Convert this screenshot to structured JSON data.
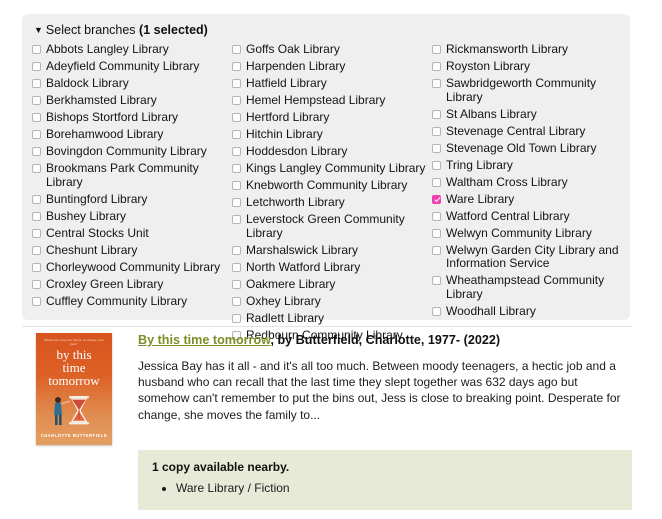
{
  "branch_filter": {
    "caret": "▼",
    "label": "Select branches",
    "count_label": "(1 selected)",
    "columns": [
      {
        "items": [
          {
            "label": "Abbots Langley Library",
            "checked": false
          },
          {
            "label": "Adeyfield Community Library",
            "checked": false
          },
          {
            "label": "Baldock Library",
            "checked": false
          },
          {
            "label": "Berkhamsted Library",
            "checked": false
          },
          {
            "label": "Bishops Stortford Library",
            "checked": false
          },
          {
            "label": "Borehamwood Library",
            "checked": false
          },
          {
            "label": "Bovingdon Community Library",
            "checked": false
          },
          {
            "label": "Brookmans Park Community Library",
            "checked": false
          },
          {
            "label": "Buntingford Library",
            "checked": false
          },
          {
            "label": "Bushey Library",
            "checked": false
          },
          {
            "label": "Central Stocks Unit",
            "checked": false
          },
          {
            "label": "Cheshunt Library",
            "checked": false
          },
          {
            "label": "Chorleywood Community Library",
            "checked": false
          },
          {
            "label": "Croxley Green Library",
            "checked": false
          },
          {
            "label": "Cuffley Community Library",
            "checked": false
          }
        ]
      },
      {
        "items": [
          {
            "label": "Goffs Oak Library",
            "checked": false
          },
          {
            "label": "Harpenden Library",
            "checked": false
          },
          {
            "label": "Hatfield Library",
            "checked": false
          },
          {
            "label": "Hemel Hempstead Library",
            "checked": false
          },
          {
            "label": "Hertford Library",
            "checked": false
          },
          {
            "label": "Hitchin Library",
            "checked": false
          },
          {
            "label": "Hoddesdon Library",
            "checked": false
          },
          {
            "label": "Kings Langley Community Library",
            "checked": false
          },
          {
            "label": "Knebworth Community Library",
            "checked": false
          },
          {
            "label": "Letchworth Library",
            "checked": false
          },
          {
            "label": "Leverstock Green Community Library",
            "checked": false
          },
          {
            "label": "Marshalswick Library",
            "checked": false
          },
          {
            "label": "North Watford Library",
            "checked": false
          },
          {
            "label": "Oakmere Library",
            "checked": false
          },
          {
            "label": "Oxhey Library",
            "checked": false
          },
          {
            "label": "Radlett Library",
            "checked": false
          },
          {
            "label": "Redbourn Community Library",
            "checked": false
          }
        ]
      },
      {
        "items": [
          {
            "label": "Rickmansworth Library",
            "checked": false
          },
          {
            "label": "Royston Library",
            "checked": false
          },
          {
            "label": "Sawbridgeworth Community Library",
            "checked": false
          },
          {
            "label": "St Albans Library",
            "checked": false
          },
          {
            "label": "Stevenage Central Library",
            "checked": false
          },
          {
            "label": "Stevenage Old Town Library",
            "checked": false
          },
          {
            "label": "Tring Library",
            "checked": false
          },
          {
            "label": "Waltham Cross Library",
            "checked": false
          },
          {
            "label": "Ware Library",
            "checked": true
          },
          {
            "label": "Watford Central Library",
            "checked": false
          },
          {
            "label": "Welwyn Community Library",
            "checked": false
          },
          {
            "label": "Welwyn Garden City Library and Information Service",
            "checked": false
          },
          {
            "label": "Wheathampstead Community Library",
            "checked": false
          },
          {
            "label": "Woodhall Library",
            "checked": false
          }
        ]
      }
    ]
  },
  "result": {
    "cover": {
      "tagline": "Would you risk your future to change your past?",
      "title": "by this time tomorrow",
      "author": "CHARLOTTE BUTTERFIELD"
    },
    "title_link": "By this time tomorrow",
    "title_rest": ", by Butterfield, Charlotte, 1977- (2022)",
    "description": "Jessica Bay has it all - and it's all too much. Between moody teenagers, a hectic job and a husband who can recall that the last time they slept together was 632 days ago but somehow can't remember to put the bins out, Jess is close to breaking point. Desperate for change, she moves the family to...",
    "availability_heading": "1 copy available nearby.",
    "availability_items": [
      "Ware Library / Fiction"
    ]
  },
  "colors": {
    "panel_bg": "#efefef",
    "checked_checkbox": "#f03fb0",
    "link": "#7d8c24",
    "availability_bg": "#e7ead6",
    "cover_orange": "#d9541f"
  }
}
